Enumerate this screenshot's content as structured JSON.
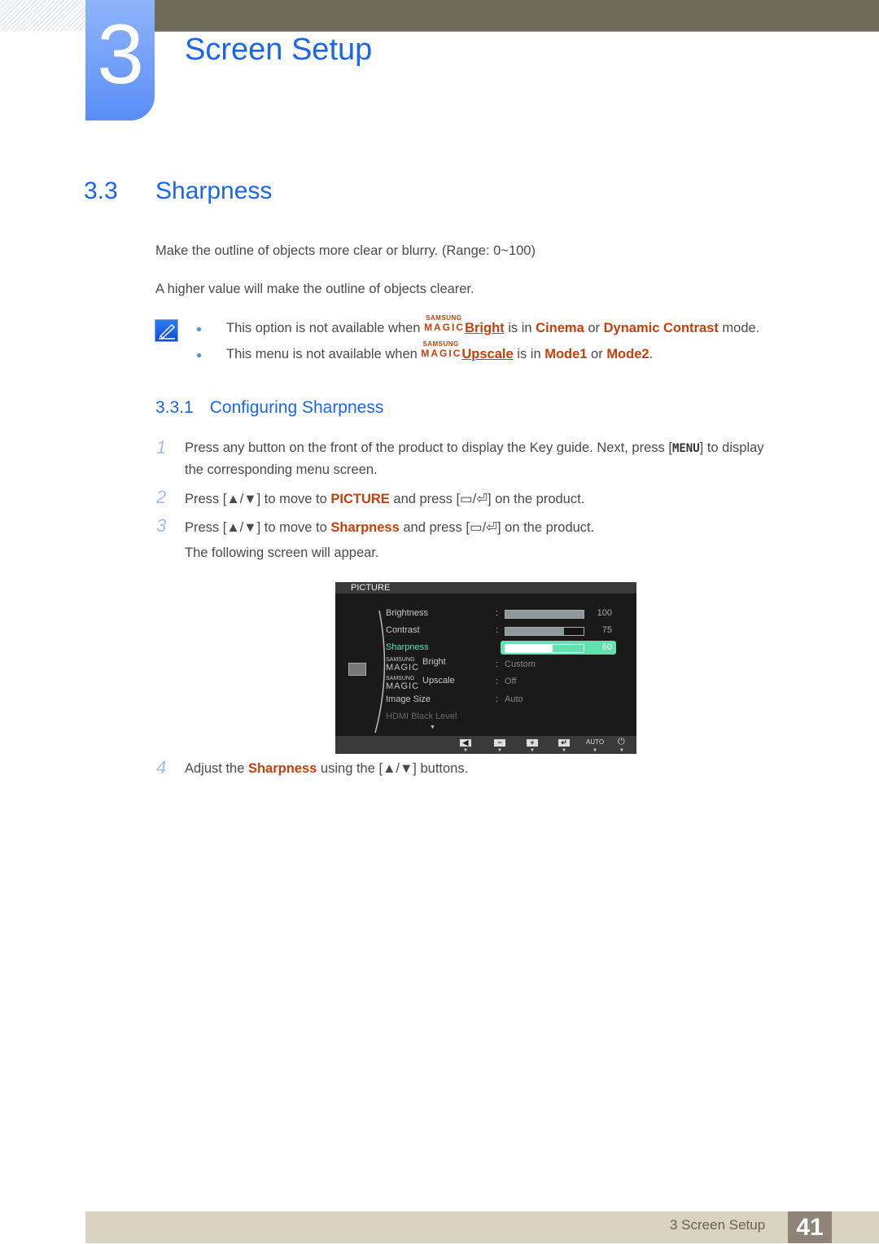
{
  "chapter": {
    "number": "3",
    "title": "Screen Setup"
  },
  "section": {
    "number": "3.3",
    "title": "Sharpness"
  },
  "intro": [
    "Make the outline of objects more clear or blurry. (Range: 0~100)",
    "A higher value will make the outline of objects clearer."
  ],
  "notes": [
    {
      "pre": "This option is not available when ",
      "magic_top": "SAMSUNG",
      "magic_bottom": "MAGIC",
      "feature": "Bright",
      "mid": " is in ",
      "opt1": "Cinema",
      "or": " or ",
      "opt2": "Dynamic Contrast",
      "post": " mode."
    },
    {
      "pre": "This menu is not available when ",
      "magic_top": "SAMSUNG",
      "magic_bottom": "MAGIC",
      "feature": "Upscale",
      "mid": " is in ",
      "opt1": "Mode1",
      "or": " or ",
      "opt2": "Mode2",
      "post": "."
    }
  ],
  "subsection": {
    "number": "3.3.1",
    "title": "Configuring Sharpness"
  },
  "steps": [
    {
      "num": "1",
      "line1_a": "Press any button on the front of the product to display the Key guide. Next, press [",
      "key": "MENU",
      "line1_b": "] to display",
      "line2": "the corresponding menu screen."
    },
    {
      "num": "2",
      "a": "Press [▲/▼] to move to ",
      "hl": "PICTURE",
      "b": " and press [▭/⏎] on the product."
    },
    {
      "num": "3",
      "a": "Press [▲/▼] to move to ",
      "hl": "Sharpness",
      "b": " and press [▭/⏎] on the product.",
      "sub": "The following screen will appear."
    },
    {
      "num": "4",
      "a": "Adjust the ",
      "hl": "Sharpness",
      "b": " using the [▲/▼] buttons."
    }
  ],
  "osd": {
    "header": "PICTURE",
    "rows": [
      {
        "label": "Brightness",
        "value": 100
      },
      {
        "label": "Contrast",
        "value": 75
      },
      {
        "label": "Sharpness",
        "value": 60
      },
      {
        "magic_top": "SAMSUNG",
        "magic_bottom": "MAGIC",
        "label": "Bright",
        "value": "Custom"
      },
      {
        "magic_top": "SAMSUNG",
        "magic_bottom": "MAGIC",
        "label": "Upscale",
        "value": "Off"
      },
      {
        "label": "Image Size",
        "value": "Auto"
      },
      {
        "label": "HDMI Black Level"
      }
    ],
    "buttons": [
      "◀",
      "−",
      "+",
      "↵",
      "AUTO",
      "⏻"
    ],
    "selected_color": "#62e0b0"
  },
  "footer": {
    "text": "3 Screen Setup",
    "page": "41"
  },
  "colors": {
    "accent_blue": "#1b66f0",
    "highlight": "#c2410c"
  }
}
